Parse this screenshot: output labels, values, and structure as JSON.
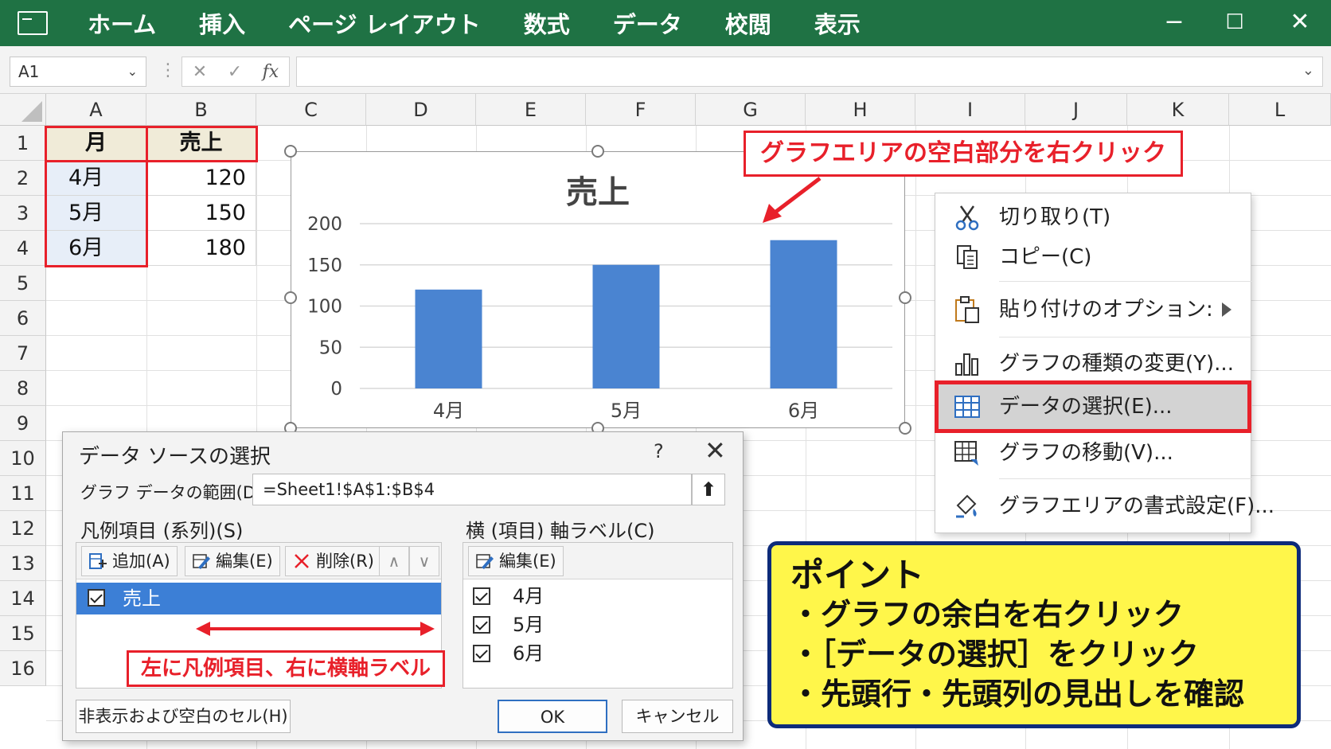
{
  "ribbon": {
    "tabs": [
      "ホーム",
      "挿入",
      "ページ レイアウト",
      "数式",
      "データ",
      "校閲",
      "表示"
    ],
    "minimize": "−",
    "maximize": "☐",
    "close": "✕",
    "color": "#1f7244"
  },
  "formula_bar": {
    "name_box": "A1",
    "cancel": "✕",
    "enter": "✓",
    "fx": "fx",
    "formula": ""
  },
  "grid": {
    "columns": [
      "A",
      "B",
      "C",
      "D",
      "E",
      "F",
      "G",
      "H",
      "I",
      "J",
      "K",
      "L"
    ],
    "rows": [
      "1",
      "2",
      "3",
      "4",
      "5",
      "6",
      "7",
      "8",
      "9",
      "10",
      "11",
      "12",
      "13",
      "14",
      "15",
      "16"
    ],
    "cells": {
      "A1": "月",
      "B1": "売上",
      "A2": "4月",
      "B2": "120",
      "A3": "5月",
      "B3": "150",
      "A4": "6月",
      "B4": "180"
    }
  },
  "chart_data": {
    "type": "bar",
    "title": "売上",
    "categories": [
      "4月",
      "5月",
      "6月"
    ],
    "values": [
      120,
      150,
      180
    ],
    "ylim": [
      0,
      200
    ],
    "yticks": [
      "0",
      "50",
      "100",
      "150",
      "200"
    ],
    "grid": true,
    "legend": "none",
    "bar_color": "#4a84d1"
  },
  "callout_top": "グラフエリアの空白部分を右クリック",
  "context_menu": {
    "items": [
      {
        "label": "切り取り(T)",
        "icon": "scissors-icon"
      },
      {
        "label": "コピー(C)",
        "icon": "copy-icon"
      },
      {
        "label": "貼り付けのオプション:",
        "icon": "paste-icon"
      },
      {
        "label": "グラフの種類の変更(Y)...",
        "icon": "chart-type-icon"
      },
      {
        "label": "データの選択(E)...",
        "icon": "select-data-icon"
      },
      {
        "label": "グラフの移動(V)...",
        "icon": "move-chart-icon"
      },
      {
        "label": "グラフエリアの書式設定(F)...",
        "icon": "format-area-icon"
      }
    ],
    "highlight_color": "#e8202a"
  },
  "dialog": {
    "title": "データ ソースの選択",
    "help": "?",
    "close": "✕",
    "range_label": "グラフ データの範囲(D):",
    "range_value": "=Sheet1!$A$1:$B$4",
    "range_btn": "⬆",
    "legend_label": "凡例項目 (系列)(S)",
    "axis_label": "横 (項目) 軸ラベル(C)",
    "btn_add": "追加(A)",
    "btn_edit": "編集(E)",
    "btn_delete": "削除(R)",
    "up": "∧",
    "down": "∨",
    "series": [
      "売上"
    ],
    "axis_edit": "編集(E)",
    "axis_items": [
      "4月",
      "5月",
      "6月"
    ],
    "note": "左に凡例項目、右に横軸ラベル",
    "hidden_cells": "非表示および空白のセル(H)",
    "ok": "OK",
    "cancel": "キャンセル"
  },
  "point_box": {
    "heading": "ポイント",
    "lines": [
      "・グラフの余白を右クリック",
      "・［データの選択］をクリック",
      "・先頭行・先頭列の見出しを確認"
    ]
  }
}
